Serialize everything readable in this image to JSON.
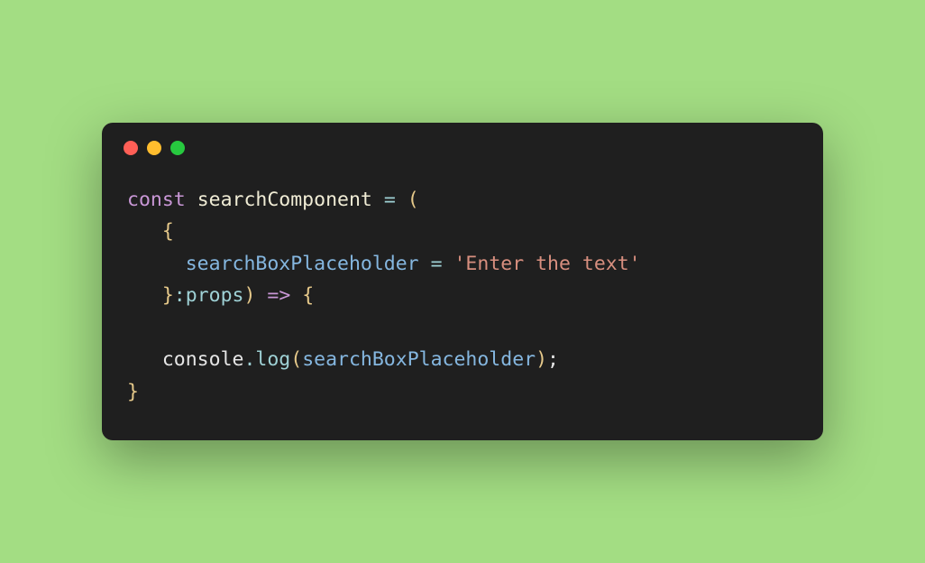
{
  "window": {
    "controls": {
      "close": "close",
      "minimize": "minimize",
      "maximize": "maximize"
    }
  },
  "code": {
    "line1": {
      "const": "const",
      "sp1": " ",
      "name": "searchComponent",
      "sp2": " ",
      "eq": "=",
      "sp3": " ",
      "paren_open": "("
    },
    "line2": {
      "indent": "   ",
      "brace_open": "{"
    },
    "line3": {
      "indent": "     ",
      "prop": "searchBoxPlaceholder",
      "sp1": " ",
      "eq": "=",
      "sp2": " ",
      "str": "'Enter the text'"
    },
    "line4": {
      "indent": "   ",
      "brace_close": "}",
      "colon": ":",
      "type": "props",
      "paren_close": ")",
      "sp1": " ",
      "arrow": "=>",
      "sp2": " ",
      "body_open": "{"
    },
    "line5": {
      "blank": ""
    },
    "line6": {
      "indent": "   ",
      "obj": "console",
      "dot": ".",
      "method": "log",
      "paren_open": "(",
      "arg": "searchBoxPlaceholder",
      "paren_close": ")",
      "semi": ";"
    },
    "line7": {
      "body_close": "}"
    }
  }
}
